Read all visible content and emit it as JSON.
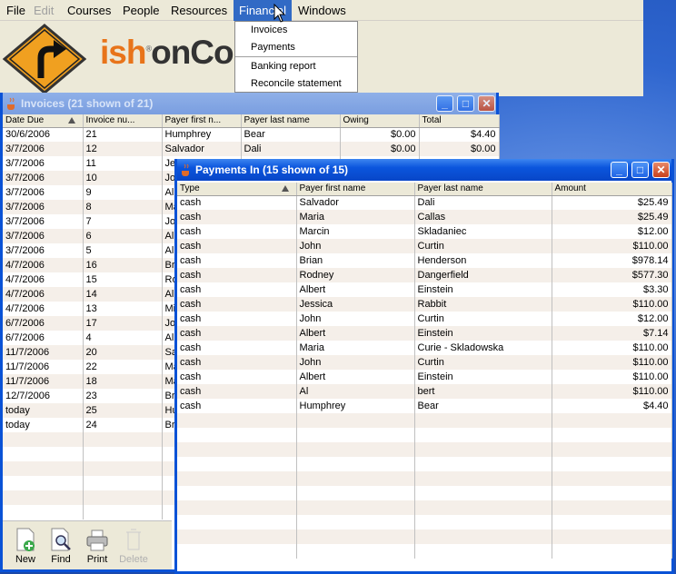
{
  "menubar": {
    "items": [
      {
        "label": "File",
        "state": "normal"
      },
      {
        "label": "Edit",
        "state": "disabled"
      },
      {
        "label": "Courses",
        "state": "normal"
      },
      {
        "label": "People",
        "state": "normal"
      },
      {
        "label": "Resources",
        "state": "normal"
      },
      {
        "label": "Financial",
        "state": "open"
      },
      {
        "label": "Windows",
        "state": "normal"
      }
    ]
  },
  "financial_menu": {
    "items": [
      "Invoices",
      "Payments",
      "Banking report",
      "Reconcile statement"
    ]
  },
  "banner": {
    "brand_part1": "ish",
    "registered": "®",
    "brand_part2": "onCou"
  },
  "invoices_window": {
    "title": "Invoices  (21 shown of 21)",
    "columns": [
      "Date Due",
      "Invoice nu...",
      "Payer first n...",
      "Payer last name",
      "Owing",
      "Total"
    ],
    "rows": [
      [
        "30/6/2006",
        "21",
        "Humphrey",
        "Bear",
        "$0.00",
        "$4.40"
      ],
      [
        "3/7/2006",
        "12",
        "Salvador",
        "Dali",
        "$0.00",
        "$0.00"
      ],
      [
        "3/7/2006",
        "11",
        "Je",
        "",
        "",
        ""
      ],
      [
        "3/7/2006",
        "10",
        "Jo",
        "",
        "",
        ""
      ],
      [
        "3/7/2006",
        "9",
        "All",
        "",
        "",
        ""
      ],
      [
        "3/7/2006",
        "8",
        "Ma",
        "",
        "",
        ""
      ],
      [
        "3/7/2006",
        "7",
        "Jo",
        "",
        "",
        ""
      ],
      [
        "3/7/2006",
        "6",
        "All",
        "",
        "",
        ""
      ],
      [
        "3/7/2006",
        "5",
        "Al",
        "",
        "",
        ""
      ],
      [
        "4/7/2006",
        "16",
        "Br",
        "",
        "",
        ""
      ],
      [
        "4/7/2006",
        "15",
        "Ro",
        "",
        "",
        ""
      ],
      [
        "4/7/2006",
        "14",
        "All",
        "",
        "",
        ""
      ],
      [
        "4/7/2006",
        "13",
        "Mi",
        "",
        "",
        ""
      ],
      [
        "6/7/2006",
        "17",
        "Jo",
        "",
        "",
        ""
      ],
      [
        "6/7/2006",
        "4",
        "All",
        "",
        "",
        ""
      ],
      [
        "11/7/2006",
        "20",
        "Sa",
        "",
        "",
        ""
      ],
      [
        "11/7/2006",
        "22",
        "Ma",
        "",
        "",
        ""
      ],
      [
        "11/7/2006",
        "18",
        "Ma",
        "",
        "",
        ""
      ],
      [
        "12/7/2006",
        "23",
        "Br",
        "",
        "",
        ""
      ],
      [
        "today",
        "25",
        "Hu",
        "",
        "",
        ""
      ],
      [
        "today",
        "24",
        "Br",
        "",
        "",
        ""
      ]
    ],
    "toolbar": {
      "new": "New",
      "find": "Find",
      "print": "Print",
      "delete": "Delete"
    }
  },
  "payments_window": {
    "title": "Payments In  (15 shown of 15)",
    "columns": [
      "Type",
      "Payer first name",
      "Payer last name",
      "Amount"
    ],
    "rows": [
      [
        "cash",
        "Salvador",
        "Dali",
        "$25.49"
      ],
      [
        "cash",
        "Maria",
        "Callas",
        "$25.49"
      ],
      [
        "cash",
        "Marcin",
        "Skladaniec",
        "$12.00"
      ],
      [
        "cash",
        "John",
        "Curtin",
        "$110.00"
      ],
      [
        "cash",
        "Brian",
        "Henderson",
        "$978.14"
      ],
      [
        "cash",
        "Rodney",
        "Dangerfield",
        "$577.30"
      ],
      [
        "cash",
        "Albert",
        "Einstein",
        "$3.30"
      ],
      [
        "cash",
        "Jessica",
        "Rabbit",
        "$110.00"
      ],
      [
        "cash",
        "John",
        "Curtin",
        "$12.00"
      ],
      [
        "cash",
        "Albert",
        "Einstein",
        "$7.14"
      ],
      [
        "cash",
        "Maria",
        "Curie - Skladowska",
        "$110.00"
      ],
      [
        "cash",
        "John",
        "Curtin",
        "$110.00"
      ],
      [
        "cash",
        "Albert",
        "Einstein",
        "$110.00"
      ],
      [
        "cash",
        "Al",
        "bert",
        "$110.00"
      ],
      [
        "cash",
        "Humphrey",
        "Bear",
        "$4.40"
      ]
    ]
  },
  "colors": {
    "titlebar_active": "#0b55dd",
    "menu_highlight": "#316ac5",
    "row_alt": "#f5efe9",
    "brand_orange": "#e8741a"
  }
}
